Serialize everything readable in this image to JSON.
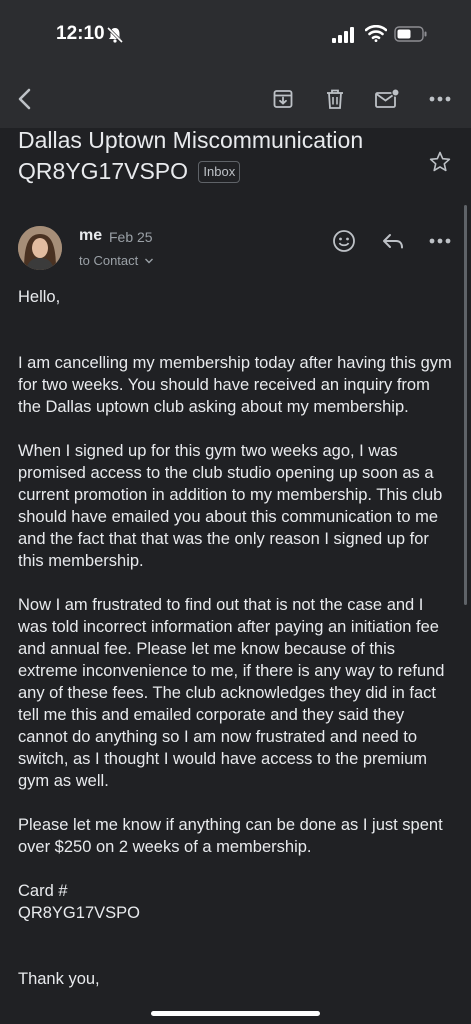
{
  "status": {
    "time": "12:10"
  },
  "toolbar": {
    "icons": [
      "back-icon",
      "archive-icon",
      "trash-icon",
      "mark-unread-icon",
      "more-icon"
    ]
  },
  "email": {
    "subject": "Dallas Uptown Miscommunication QR8YG17VSPO",
    "label": "Inbox",
    "sender": "me",
    "date": "Feb 25",
    "to": "to Contact",
    "body": {
      "greeting": "Hello,",
      "p1": "I am cancelling my membership today after having this gym for two weeks. You should have received an inquiry from the Dallas uptown club asking about my membership.",
      "p2": "When I signed up for this gym two weeks ago, I was promised access to the club studio opening up soon as a current promotion in addition to my membership. This club should have emailed you about this communication to me and the fact that that was the only reason I signed up for this membership.",
      "p3": "Now I am frustrated to find out that is not the case and I was told incorrect information after paying an initiation fee and annual fee. Please let me know because of this extreme inconvenience to me, if there is any way to refund any of these fees. The club acknowledges they did in fact tell me this and emailed corporate and they said they cannot do anything so I am now frustrated and need to switch, as I thought I would have access to the premium gym as well.",
      "p4": "Please let me know if anything can be done as I just spent over $250 on 2 weeks of a membership.",
      "card_label": "Card #",
      "card_number": "QR8YG17VSPO",
      "signoff": "Thank you,"
    }
  },
  "colors": {
    "background": "#202124",
    "bar": "#2c2d30",
    "text": "#e8eaed",
    "muted": "#9aa0a6"
  }
}
